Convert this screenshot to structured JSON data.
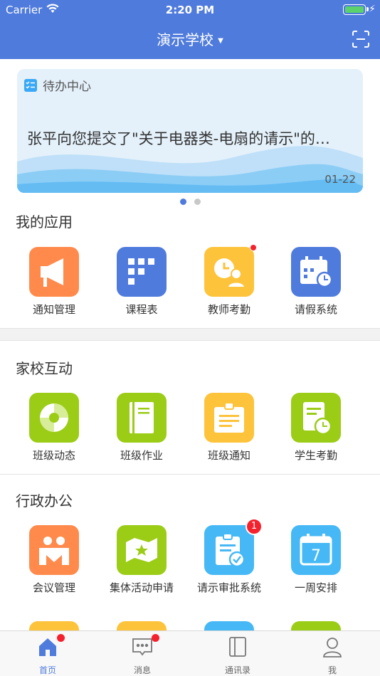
{
  "status_bar": {
    "carrier": "Carrier",
    "time": "2:20 PM"
  },
  "header": {
    "title": "演示学校",
    "dropdown_icon": "caret-down-icon",
    "scan_icon": "scan-icon"
  },
  "banner": {
    "title": "待办中心",
    "message": "张平向您提交了\"关于电器类-电扇的请示\"的…",
    "date": "01-22",
    "page_count": 2,
    "active_page": 1
  },
  "sections": [
    {
      "title": "我的应用",
      "apps": [
        {
          "label": "通知管理",
          "icon": "megaphone-icon",
          "color": "#ff8a4c"
        },
        {
          "label": "课程表",
          "icon": "schedule-grid-icon",
          "color": "#4f7bdc"
        },
        {
          "label": "教师考勤",
          "icon": "clock-person-icon",
          "color": "#fdc33a",
          "badge_dot": true
        },
        {
          "label": "请假系统",
          "icon": "calendar-clock-icon",
          "color": "#4f7bdc"
        }
      ]
    },
    {
      "title": "家校互动",
      "apps": [
        {
          "label": "班级动态",
          "icon": "aperture-icon",
          "color": "#9bcc16"
        },
        {
          "label": "班级作业",
          "icon": "notebook-icon",
          "color": "#9bcc16"
        },
        {
          "label": "班级通知",
          "icon": "clipboard-icon",
          "color": "#fdc33a"
        },
        {
          "label": "学生考勤",
          "icon": "document-clock-icon",
          "color": "#9bcc16"
        }
      ]
    },
    {
      "title": "行政办公",
      "apps": [
        {
          "label": "会议管理",
          "icon": "meeting-icon",
          "color": "#ff8a4c"
        },
        {
          "label": "集体活动申请",
          "icon": "flag-star-icon",
          "color": "#9bcc16"
        },
        {
          "label": "请示审批系统",
          "icon": "clipboard-check-icon",
          "color": "#45b8f5",
          "badge": "1"
        },
        {
          "label": "一周安排",
          "icon": "calendar-7-icon",
          "color": "#45b8f5"
        }
      ]
    }
  ],
  "peek_colors": [
    "#fdc33a",
    "#fdc33a",
    "#45b8f5",
    "#9bcc16"
  ],
  "tabbar": [
    {
      "label": "首页",
      "icon": "home-icon",
      "active": true,
      "badge_dot": true
    },
    {
      "label": "消息",
      "icon": "message-icon",
      "active": false,
      "badge_dot": true
    },
    {
      "label": "通讯录",
      "icon": "contacts-book-icon",
      "active": false
    },
    {
      "label": "我",
      "icon": "person-icon",
      "active": false
    }
  ],
  "colors": {
    "primary": "#4f7bdc",
    "badge": "#f5222d"
  }
}
